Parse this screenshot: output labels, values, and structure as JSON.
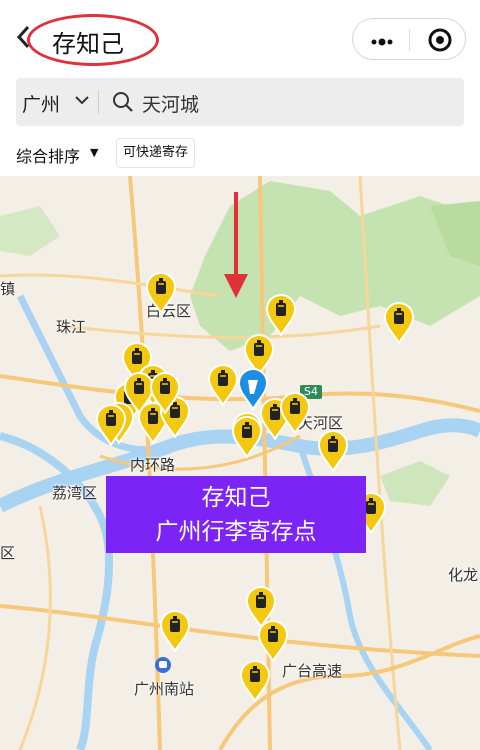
{
  "header": {
    "title": "存知己",
    "back_icon": "chevron-left-icon",
    "more_icon": "more-dots-icon",
    "close_icon": "target-circle-icon"
  },
  "search": {
    "city": "广州",
    "query": "天河城"
  },
  "filters": {
    "sort_label": "综合排序",
    "chip_label": "可快递寄存"
  },
  "map": {
    "labels": {
      "baiyun": "白云区",
      "tianhe": "天河区",
      "liwan": "荔湾区",
      "neihuan": "内环路",
      "zhujiang": "珠江",
      "huanan_station": "广州南站",
      "guangtai": "广台高速",
      "zhen": "镇",
      "huilong": "化龙",
      "qu": "区",
      "s4": "S4"
    },
    "overlay_line1": "存知己",
    "overlay_line2": "广州行李寄存点"
  },
  "colors": {
    "annotation_red": "#e0313b",
    "overlay_purple": "#7b24f5",
    "pin_yellow": "#f2c811",
    "current_pin_blue": "#1c8fe0"
  }
}
